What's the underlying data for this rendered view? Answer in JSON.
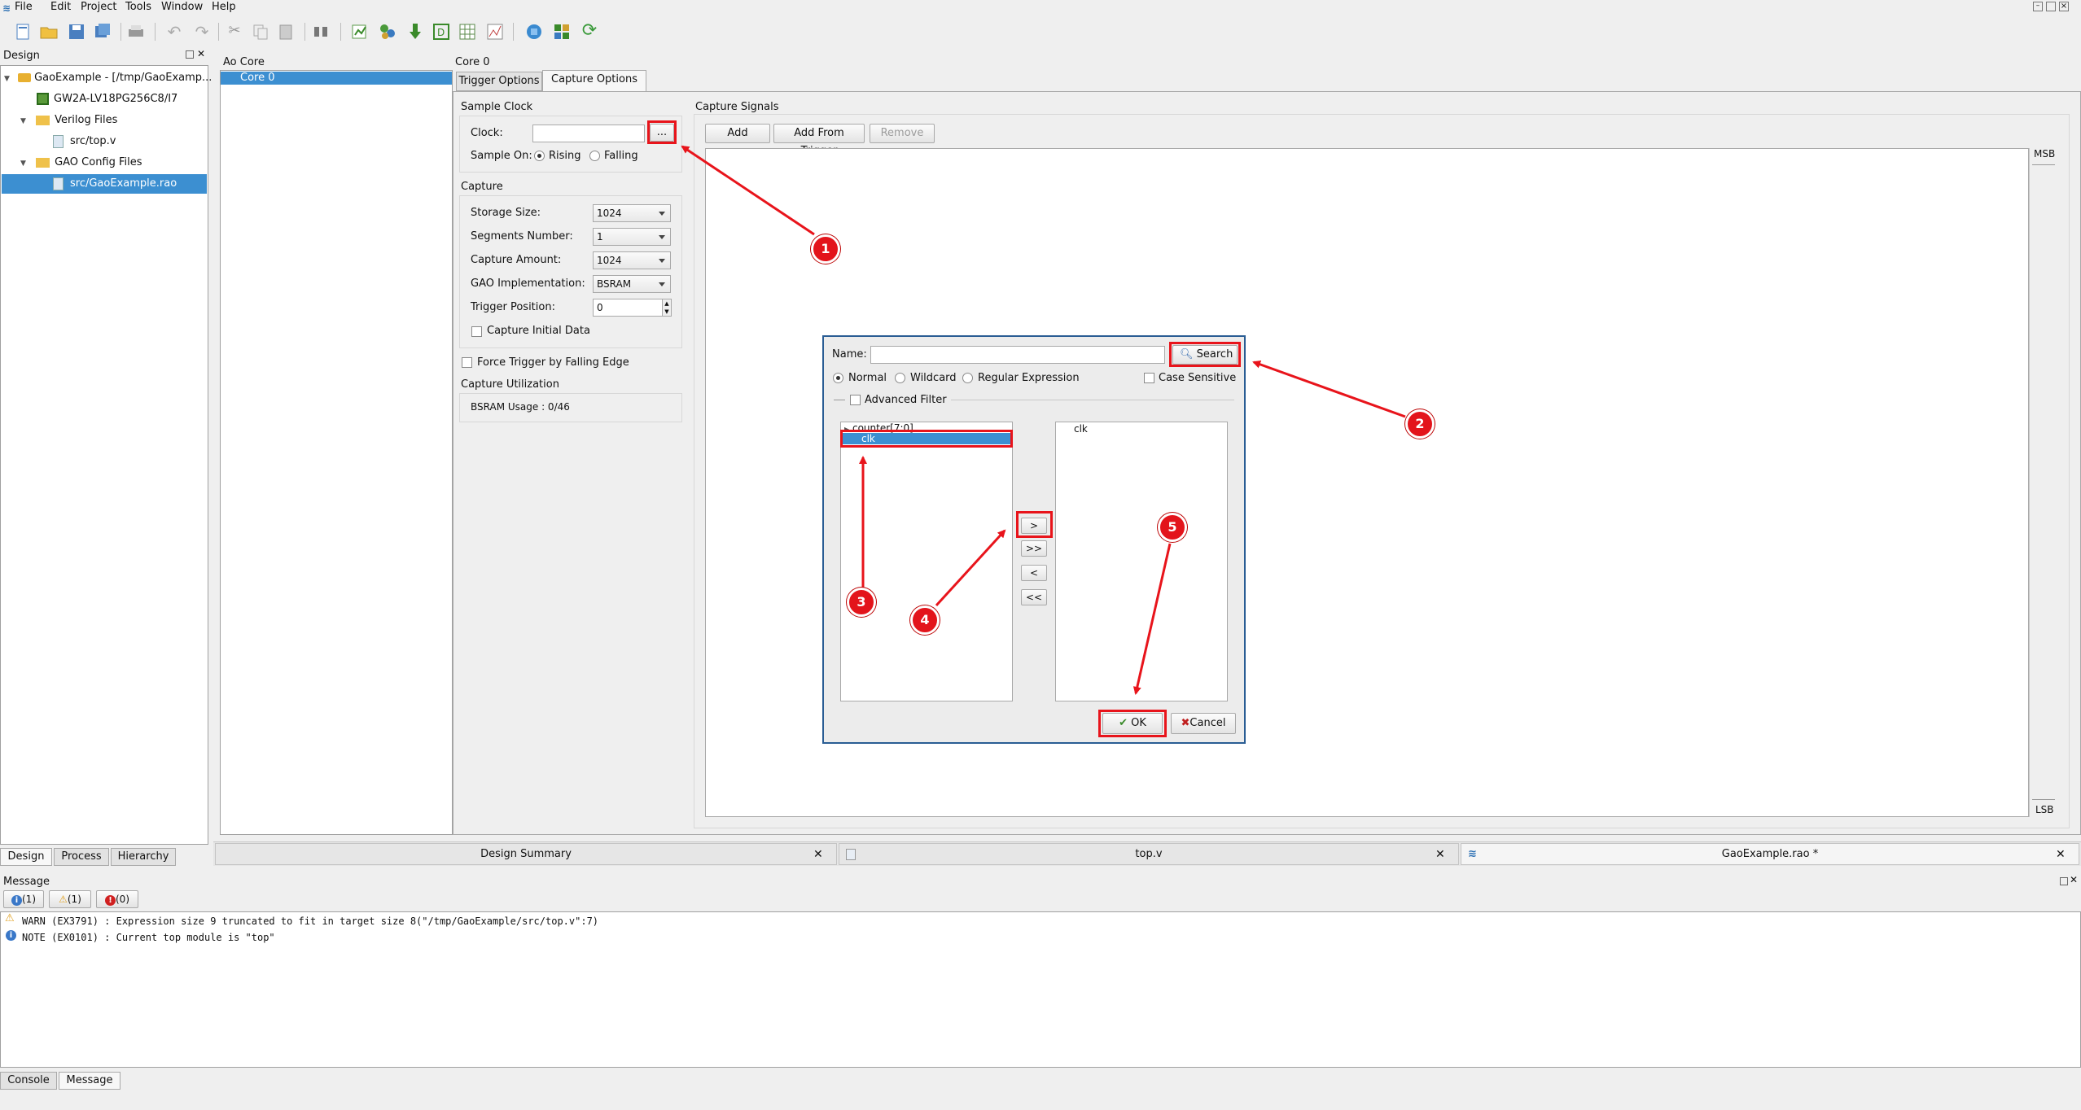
{
  "menubar": {
    "items": [
      "File",
      "Edit",
      "Project",
      "Tools",
      "Window",
      "Help"
    ]
  },
  "toolbar": {
    "icons": [
      "new-file-icon",
      "open-folder-icon",
      "save-icon",
      "save-all-icon",
      "print-icon",
      "undo-icon",
      "redo-icon",
      "cut-icon",
      "copy-icon",
      "paste-icon",
      "find-icon",
      "synthesize-icon",
      "place-route-icon",
      "program-icon",
      "gao-icon",
      "floorplan-icon",
      "timing-icon",
      "ip-core-icon",
      "schematic-icon",
      "refresh-icon"
    ]
  },
  "design_panel": {
    "title": "Design",
    "tree": {
      "project": "GaoExample - [/tmp/GaoExamp...",
      "device": "GW2A-LV18PG256C8/I7",
      "verilog_folder": "Verilog Files",
      "verilog_file": "src/top.v",
      "gao_folder": "GAO Config Files",
      "gao_file": "src/GaoExample.rao"
    },
    "tabs": [
      "Design",
      "Process",
      "Hierarchy"
    ]
  },
  "ao_core": {
    "title": "Ao Core",
    "item": "Core 0"
  },
  "core": {
    "title": "Core 0",
    "tabs": [
      "Trigger Options",
      "Capture Options"
    ],
    "active_tab": "Capture Options"
  },
  "sample_clock": {
    "title": "Sample Clock",
    "clock_label": "Clock:",
    "clock_value": "",
    "browse_label": "...",
    "sample_on_label": "Sample On:",
    "rising": "Rising",
    "falling": "Falling"
  },
  "capture": {
    "title": "Capture",
    "storage_size_label": "Storage Size:",
    "storage_size": "1024",
    "segments_label": "Segments Number:",
    "segments": "1",
    "amount_label": "Capture Amount:",
    "amount": "1024",
    "impl_label": "GAO Implementation:",
    "impl": "BSRAM",
    "trigger_pos_label": "Trigger Position:",
    "trigger_pos": "0",
    "initial_data": "Capture Initial Data"
  },
  "force_trigger": "Force Trigger by Falling Edge",
  "utilization": {
    "title": "Capture Utilization",
    "bsram": "BSRAM Usage :  0/46"
  },
  "capture_signals": {
    "title": "Capture Signals",
    "add": "Add",
    "add_from_trigger": "Add From Trigger",
    "remove": "Remove",
    "msb": "MSB",
    "lsb": "LSB"
  },
  "dialog": {
    "name_label": "Name:",
    "name_value": "",
    "search": "Search",
    "normal": "Normal",
    "wildcard": "Wildcard",
    "regex": "Regular Expression",
    "case_sensitive": "Case Sensitive",
    "advanced_filter": "Advanced Filter",
    "left_items": [
      "counter[7:0]",
      "clk"
    ],
    "right_items": [
      "clk"
    ],
    "move_right": ">",
    "move_all_right": ">>",
    "move_left": "<",
    "move_all_left": "<<",
    "ok": "OK",
    "cancel": "Cancel"
  },
  "doc_tabs": [
    "Design Summary",
    "top.v",
    "GaoExample.rao *"
  ],
  "message": {
    "title": "Message",
    "filters": [
      "(1)",
      "(1)",
      "(0)"
    ],
    "lines": [
      "WARN  (EX3791) : Expression size 9 truncated to fit in target size 8(\"/tmp/GaoExample/src/top.v\":7)",
      "NOTE  (EX0101) : Current top module is \"top\""
    ]
  },
  "bottom_tabs": [
    "Console",
    "Message"
  ],
  "annotations": [
    "1",
    "2",
    "3",
    "4",
    "5"
  ],
  "colors": {
    "accent": "#e8141b",
    "selection": "#3c8fd1"
  }
}
